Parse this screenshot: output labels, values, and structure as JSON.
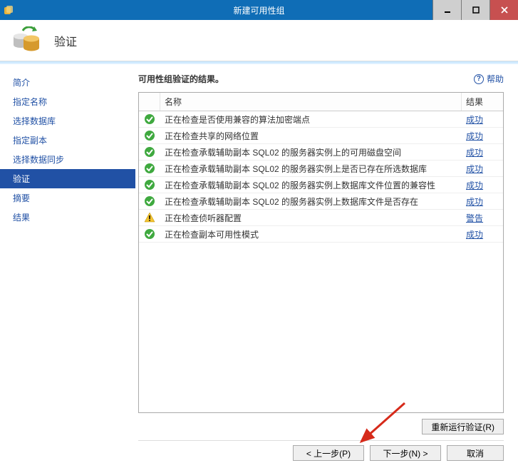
{
  "titlebar": {
    "title": "新建可用性组"
  },
  "header": {
    "title": "验证"
  },
  "help_label": "帮助",
  "sidebar": {
    "items": [
      {
        "label": "简介"
      },
      {
        "label": "指定名称"
      },
      {
        "label": "选择数据库"
      },
      {
        "label": "指定副本"
      },
      {
        "label": "选择数据同步"
      },
      {
        "label": "验证"
      },
      {
        "label": "摘要"
      },
      {
        "label": "结果"
      }
    ],
    "active_index": 5
  },
  "content": {
    "heading": "可用性组验证的结果。",
    "columns": {
      "name": "名称",
      "result": "结果"
    },
    "rows": [
      {
        "status": "ok",
        "name": "正在检查是否使用兼容的算法加密端点",
        "result": "成功"
      },
      {
        "status": "ok",
        "name": "正在检查共享的网络位置",
        "result": "成功"
      },
      {
        "status": "ok",
        "name": "正在检查承载辅助副本 SQL02 的服务器实例上的可用磁盘空间",
        "result": "成功"
      },
      {
        "status": "ok",
        "name": "正在检查承载辅助副本 SQL02 的服务器实例上是否已存在所选数据库",
        "result": "成功"
      },
      {
        "status": "ok",
        "name": "正在检查承载辅助副本 SQL02 的服务器实例上数据库文件位置的兼容性",
        "result": "成功"
      },
      {
        "status": "ok",
        "name": "正在检查承载辅助副本 SQL02 的服务器实例上数据库文件是否存在",
        "result": "成功"
      },
      {
        "status": "warn",
        "name": "正在检查侦听器配置",
        "result": "警告"
      },
      {
        "status": "ok",
        "name": "正在检查副本可用性模式",
        "result": "成功"
      }
    ]
  },
  "buttons": {
    "rerun": "重新运行验证(R)",
    "prev": "< 上一步(P)",
    "next": "下一步(N) >",
    "cancel": "取消"
  }
}
